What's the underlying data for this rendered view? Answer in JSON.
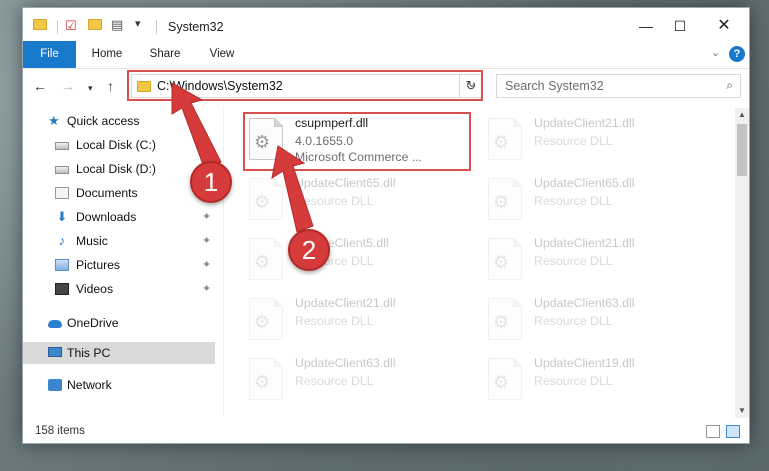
{
  "window": {
    "title": "System32"
  },
  "ribbon": {
    "tabs": [
      "File",
      "Home",
      "Share",
      "View"
    ]
  },
  "nav": {
    "address_path": "C:\\Windows\\System32",
    "search_placeholder": "Search System32"
  },
  "sidebar": {
    "items": [
      {
        "label": "Quick access",
        "icon": "star-icon",
        "pinned": false
      },
      {
        "label": "Local Disk (C:)",
        "icon": "drive-icon",
        "pinned": true
      },
      {
        "label": "Local Disk (D:)",
        "icon": "drive-icon",
        "pinned": true
      },
      {
        "label": "Documents",
        "icon": "documents-icon",
        "pinned": true
      },
      {
        "label": "Downloads",
        "icon": "download-icon",
        "pinned": true
      },
      {
        "label": "Music",
        "icon": "music-icon",
        "pinned": true
      },
      {
        "label": "Pictures",
        "icon": "pictures-icon",
        "pinned": true
      },
      {
        "label": "Videos",
        "icon": "videos-icon",
        "pinned": true
      },
      {
        "label": "OneDrive",
        "icon": "cloud-icon",
        "pinned": false
      },
      {
        "label": "This PC",
        "icon": "computer-icon",
        "pinned": false,
        "selected": true
      },
      {
        "label": "Network",
        "icon": "network-icon",
        "pinned": false
      }
    ]
  },
  "files": [
    {
      "name": "csupmperf.dll",
      "version": "4.0.1655.0",
      "description": "Microsoft Commerce ...",
      "highlighted": true
    },
    {
      "name": "UpdateClient21.dll",
      "description": "Resource DLL"
    },
    {
      "name": "UpdateClient65.dll",
      "description": "Resource DLL"
    },
    {
      "name": "UpdateClient65.dll",
      "description": "Resource DLL"
    },
    {
      "name": "UpdateClient5.dll",
      "description": "Resource DLL"
    },
    {
      "name": "UpdateClient21.dll",
      "description": "Resource DLL"
    },
    {
      "name": "UpdateClient21.dll",
      "description": "Resource DLL"
    },
    {
      "name": "UpdateClient63.dll",
      "description": "Resource DLL"
    },
    {
      "name": "UpdateClient63.dll",
      "description": "Resource DLL"
    },
    {
      "name": "UpdateClient19.dll",
      "description": "Resource DLL"
    }
  ],
  "status": {
    "item_count": "158 items"
  },
  "callouts": [
    "1",
    "2"
  ],
  "colors": {
    "accent": "#1979ca",
    "highlight": "#d9514e",
    "badge": "#d63b3b"
  }
}
